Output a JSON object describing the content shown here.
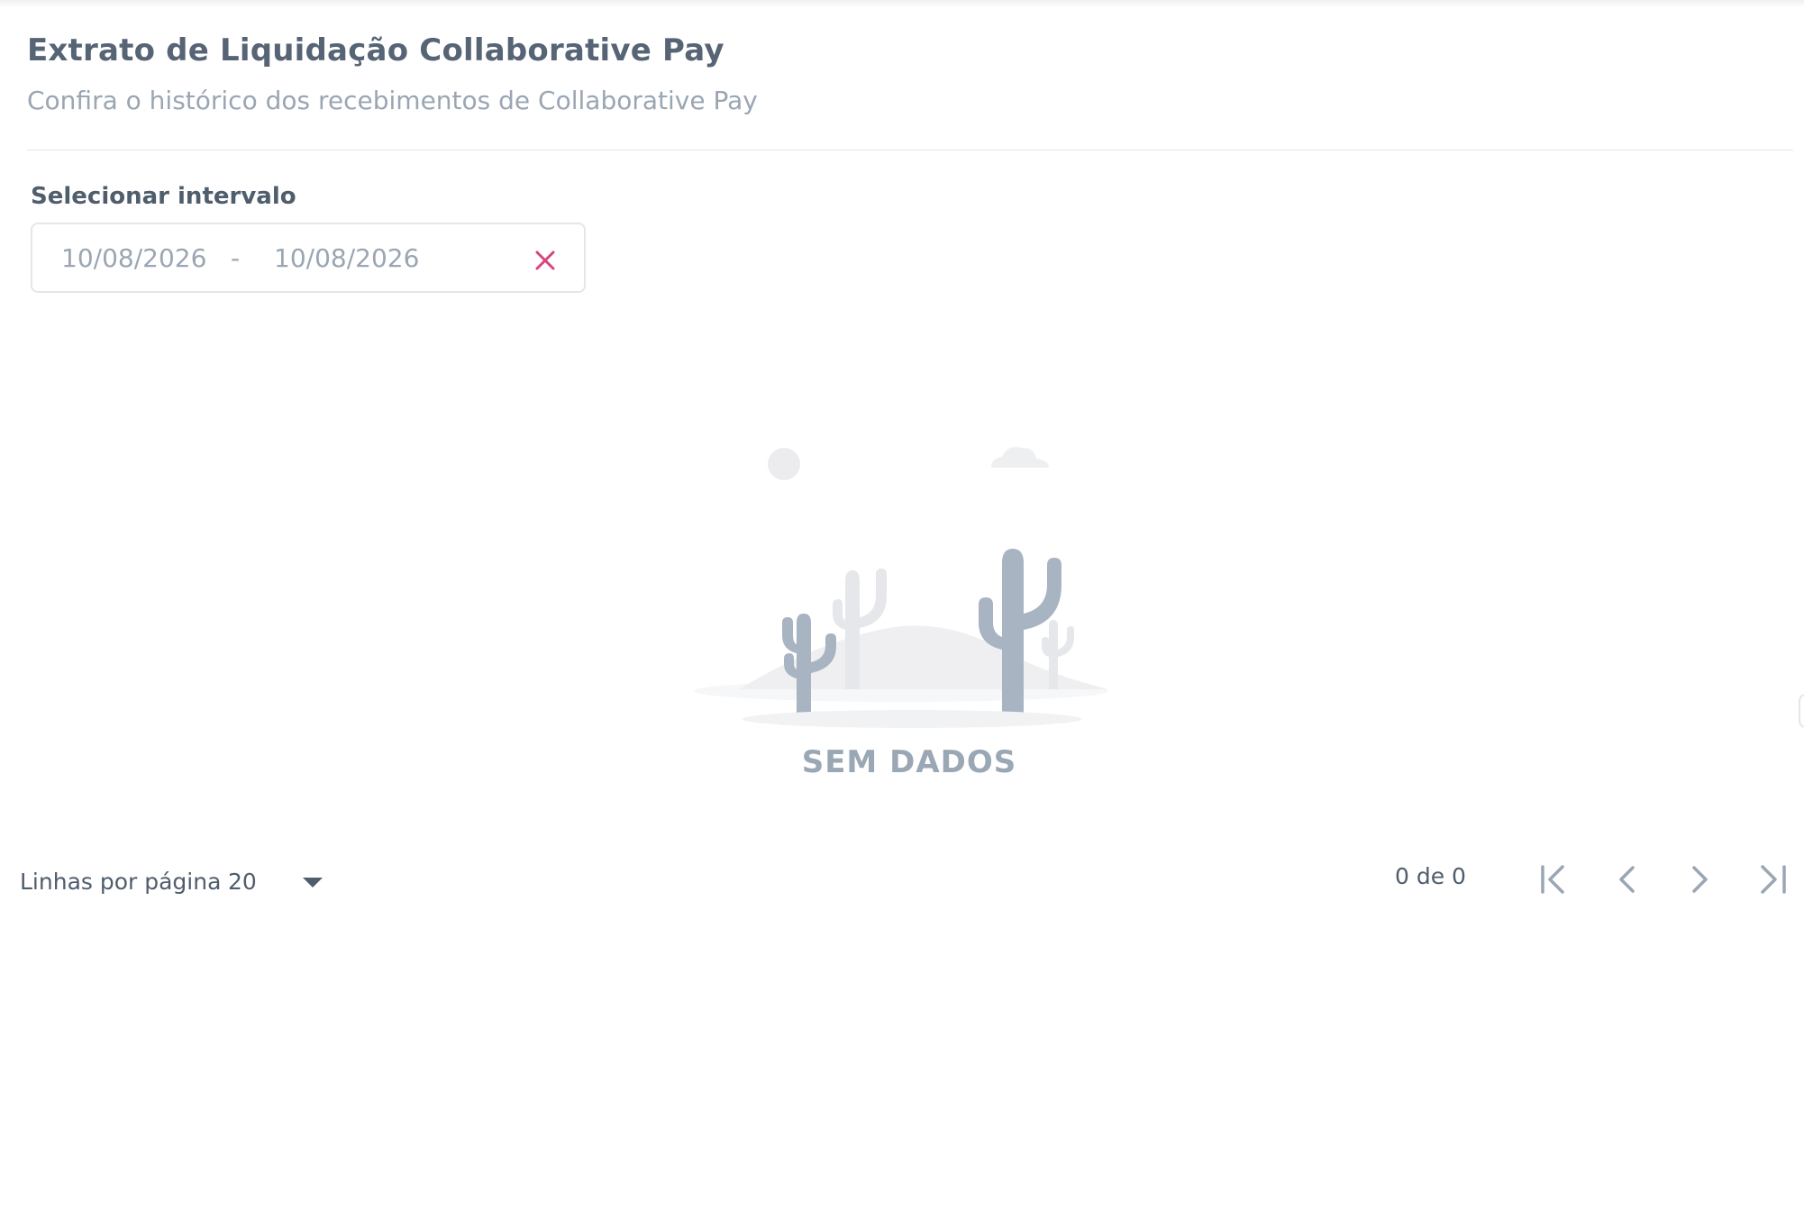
{
  "header": {
    "title": "Extrato de Liquidação Collaborative Pay",
    "subtitle": "Confira o histórico dos recebimentos de Collaborative Pay"
  },
  "filter": {
    "label": "Selecionar intervalo",
    "start_date": "10/08/2026",
    "separator": "-",
    "end_date": "10/08/2026",
    "clear_icon": "close-icon",
    "clear_color": "#d6457e"
  },
  "empty_state": {
    "text": "SEM DADOS",
    "illustration": "desert-cactus-icon"
  },
  "pagination": {
    "rows_label": "Linhas por página",
    "rows_value": "20",
    "count_text": "0 de 0",
    "icons": [
      "first-page-icon",
      "prev-page-icon",
      "next-page-icon",
      "last-page-icon"
    ]
  },
  "colors": {
    "text_primary": "#4f5d6c",
    "text_muted": "#9aa6b3",
    "border": "#e3e6ea",
    "accent": "#d6457e"
  }
}
